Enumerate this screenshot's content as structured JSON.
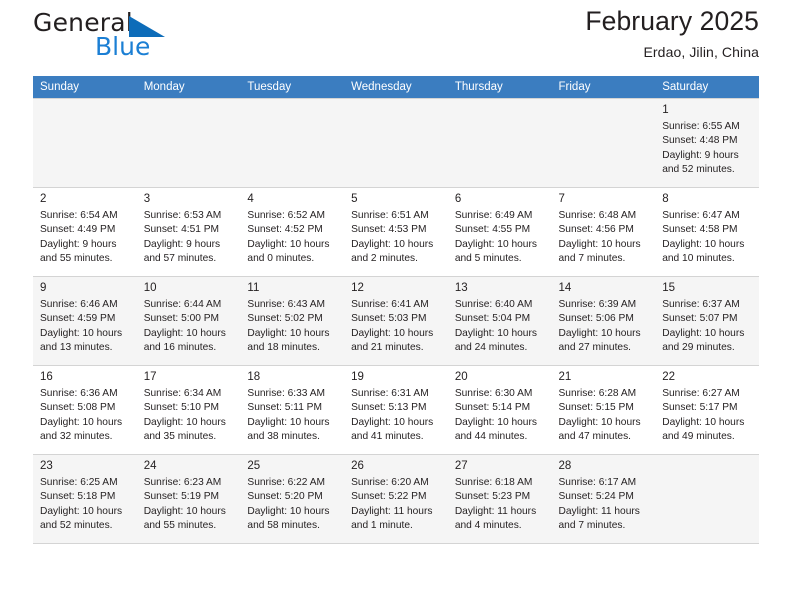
{
  "brand": {
    "name_part1": "General",
    "name_part2": "Blue",
    "triangle_icon": "triangle-icon",
    "accent_color": "#1b7fd4"
  },
  "header": {
    "title": "February 2025",
    "subtitle": "Erdao, Jilin, China"
  },
  "colors": {
    "header_row_bg": "#3b7dc0",
    "header_row_text": "#ffffff",
    "alt_row_bg": "#f5f5f5",
    "row_bg": "#ffffff",
    "border": "#d4d4d4",
    "text": "#231f20"
  },
  "weekday_headers": [
    "Sunday",
    "Monday",
    "Tuesday",
    "Wednesday",
    "Thursday",
    "Friday",
    "Saturday"
  ],
  "weeks": [
    [
      {
        "day": "",
        "sunrise": "",
        "sunset": "",
        "daylight_line1": "",
        "daylight_line2": ""
      },
      {
        "day": "",
        "sunrise": "",
        "sunset": "",
        "daylight_line1": "",
        "daylight_line2": ""
      },
      {
        "day": "",
        "sunrise": "",
        "sunset": "",
        "daylight_line1": "",
        "daylight_line2": ""
      },
      {
        "day": "",
        "sunrise": "",
        "sunset": "",
        "daylight_line1": "",
        "daylight_line2": ""
      },
      {
        "day": "",
        "sunrise": "",
        "sunset": "",
        "daylight_line1": "",
        "daylight_line2": ""
      },
      {
        "day": "",
        "sunrise": "",
        "sunset": "",
        "daylight_line1": "",
        "daylight_line2": ""
      },
      {
        "day": "1",
        "sunrise": "Sunrise: 6:55 AM",
        "sunset": "Sunset: 4:48 PM",
        "daylight_line1": "Daylight: 9 hours",
        "daylight_line2": "and 52 minutes."
      }
    ],
    [
      {
        "day": "2",
        "sunrise": "Sunrise: 6:54 AM",
        "sunset": "Sunset: 4:49 PM",
        "daylight_line1": "Daylight: 9 hours",
        "daylight_line2": "and 55 minutes."
      },
      {
        "day": "3",
        "sunrise": "Sunrise: 6:53 AM",
        "sunset": "Sunset: 4:51 PM",
        "daylight_line1": "Daylight: 9 hours",
        "daylight_line2": "and 57 minutes."
      },
      {
        "day": "4",
        "sunrise": "Sunrise: 6:52 AM",
        "sunset": "Sunset: 4:52 PM",
        "daylight_line1": "Daylight: 10 hours",
        "daylight_line2": "and 0 minutes."
      },
      {
        "day": "5",
        "sunrise": "Sunrise: 6:51 AM",
        "sunset": "Sunset: 4:53 PM",
        "daylight_line1": "Daylight: 10 hours",
        "daylight_line2": "and 2 minutes."
      },
      {
        "day": "6",
        "sunrise": "Sunrise: 6:49 AM",
        "sunset": "Sunset: 4:55 PM",
        "daylight_line1": "Daylight: 10 hours",
        "daylight_line2": "and 5 minutes."
      },
      {
        "day": "7",
        "sunrise": "Sunrise: 6:48 AM",
        "sunset": "Sunset: 4:56 PM",
        "daylight_line1": "Daylight: 10 hours",
        "daylight_line2": "and 7 minutes."
      },
      {
        "day": "8",
        "sunrise": "Sunrise: 6:47 AM",
        "sunset": "Sunset: 4:58 PM",
        "daylight_line1": "Daylight: 10 hours",
        "daylight_line2": "and 10 minutes."
      }
    ],
    [
      {
        "day": "9",
        "sunrise": "Sunrise: 6:46 AM",
        "sunset": "Sunset: 4:59 PM",
        "daylight_line1": "Daylight: 10 hours",
        "daylight_line2": "and 13 minutes."
      },
      {
        "day": "10",
        "sunrise": "Sunrise: 6:44 AM",
        "sunset": "Sunset: 5:00 PM",
        "daylight_line1": "Daylight: 10 hours",
        "daylight_line2": "and 16 minutes."
      },
      {
        "day": "11",
        "sunrise": "Sunrise: 6:43 AM",
        "sunset": "Sunset: 5:02 PM",
        "daylight_line1": "Daylight: 10 hours",
        "daylight_line2": "and 18 minutes."
      },
      {
        "day": "12",
        "sunrise": "Sunrise: 6:41 AM",
        "sunset": "Sunset: 5:03 PM",
        "daylight_line1": "Daylight: 10 hours",
        "daylight_line2": "and 21 minutes."
      },
      {
        "day": "13",
        "sunrise": "Sunrise: 6:40 AM",
        "sunset": "Sunset: 5:04 PM",
        "daylight_line1": "Daylight: 10 hours",
        "daylight_line2": "and 24 minutes."
      },
      {
        "day": "14",
        "sunrise": "Sunrise: 6:39 AM",
        "sunset": "Sunset: 5:06 PM",
        "daylight_line1": "Daylight: 10 hours",
        "daylight_line2": "and 27 minutes."
      },
      {
        "day": "15",
        "sunrise": "Sunrise: 6:37 AM",
        "sunset": "Sunset: 5:07 PM",
        "daylight_line1": "Daylight: 10 hours",
        "daylight_line2": "and 29 minutes."
      }
    ],
    [
      {
        "day": "16",
        "sunrise": "Sunrise: 6:36 AM",
        "sunset": "Sunset: 5:08 PM",
        "daylight_line1": "Daylight: 10 hours",
        "daylight_line2": "and 32 minutes."
      },
      {
        "day": "17",
        "sunrise": "Sunrise: 6:34 AM",
        "sunset": "Sunset: 5:10 PM",
        "daylight_line1": "Daylight: 10 hours",
        "daylight_line2": "and 35 minutes."
      },
      {
        "day": "18",
        "sunrise": "Sunrise: 6:33 AM",
        "sunset": "Sunset: 5:11 PM",
        "daylight_line1": "Daylight: 10 hours",
        "daylight_line2": "and 38 minutes."
      },
      {
        "day": "19",
        "sunrise": "Sunrise: 6:31 AM",
        "sunset": "Sunset: 5:13 PM",
        "daylight_line1": "Daylight: 10 hours",
        "daylight_line2": "and 41 minutes."
      },
      {
        "day": "20",
        "sunrise": "Sunrise: 6:30 AM",
        "sunset": "Sunset: 5:14 PM",
        "daylight_line1": "Daylight: 10 hours",
        "daylight_line2": "and 44 minutes."
      },
      {
        "day": "21",
        "sunrise": "Sunrise: 6:28 AM",
        "sunset": "Sunset: 5:15 PM",
        "daylight_line1": "Daylight: 10 hours",
        "daylight_line2": "and 47 minutes."
      },
      {
        "day": "22",
        "sunrise": "Sunrise: 6:27 AM",
        "sunset": "Sunset: 5:17 PM",
        "daylight_line1": "Daylight: 10 hours",
        "daylight_line2": "and 49 minutes."
      }
    ],
    [
      {
        "day": "23",
        "sunrise": "Sunrise: 6:25 AM",
        "sunset": "Sunset: 5:18 PM",
        "daylight_line1": "Daylight: 10 hours",
        "daylight_line2": "and 52 minutes."
      },
      {
        "day": "24",
        "sunrise": "Sunrise: 6:23 AM",
        "sunset": "Sunset: 5:19 PM",
        "daylight_line1": "Daylight: 10 hours",
        "daylight_line2": "and 55 minutes."
      },
      {
        "day": "25",
        "sunrise": "Sunrise: 6:22 AM",
        "sunset": "Sunset: 5:20 PM",
        "daylight_line1": "Daylight: 10 hours",
        "daylight_line2": "and 58 minutes."
      },
      {
        "day": "26",
        "sunrise": "Sunrise: 6:20 AM",
        "sunset": "Sunset: 5:22 PM",
        "daylight_line1": "Daylight: 11 hours",
        "daylight_line2": "and 1 minute."
      },
      {
        "day": "27",
        "sunrise": "Sunrise: 6:18 AM",
        "sunset": "Sunset: 5:23 PM",
        "daylight_line1": "Daylight: 11 hours",
        "daylight_line2": "and 4 minutes."
      },
      {
        "day": "28",
        "sunrise": "Sunrise: 6:17 AM",
        "sunset": "Sunset: 5:24 PM",
        "daylight_line1": "Daylight: 11 hours",
        "daylight_line2": "and 7 minutes."
      },
      {
        "day": "",
        "sunrise": "",
        "sunset": "",
        "daylight_line1": "",
        "daylight_line2": ""
      }
    ]
  ]
}
